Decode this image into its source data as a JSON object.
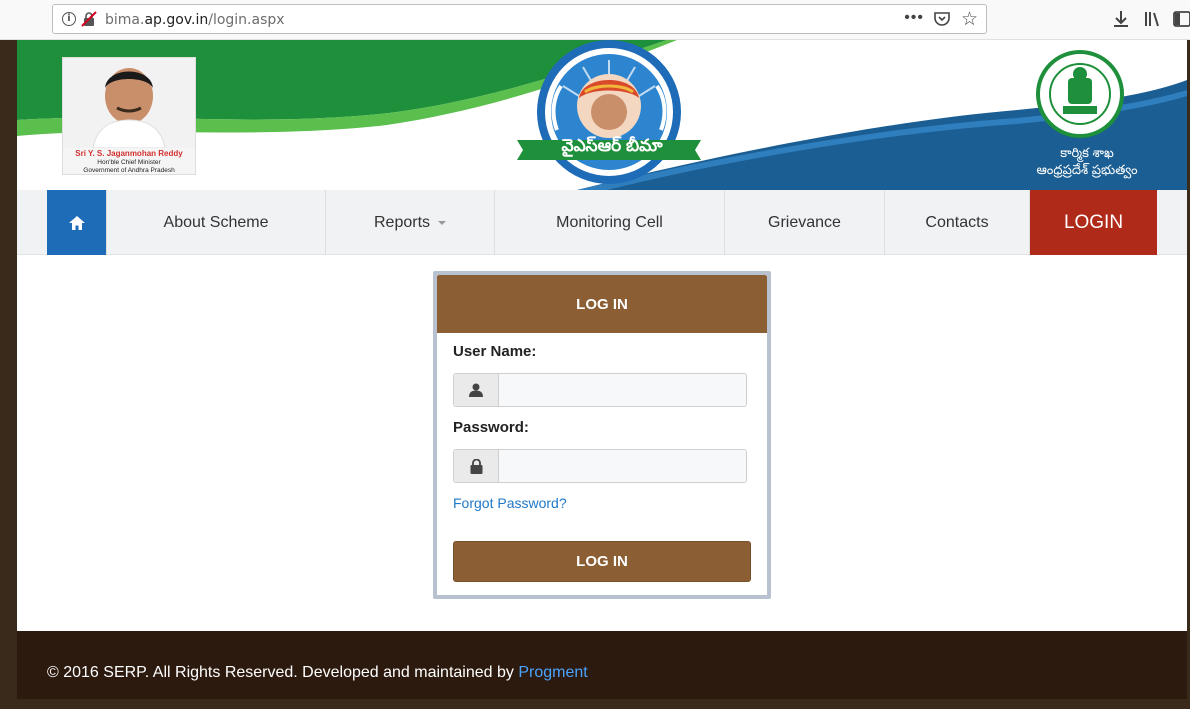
{
  "browser": {
    "url_prefix": "bima.",
    "url_domain": "ap.gov.in",
    "url_path": "/login.aspx",
    "more_glyph": "•••"
  },
  "header": {
    "cm_name": "Sri Y. S. Jaganmohan Reddy",
    "cm_title": "Hon'ble Chief Minister",
    "cm_govt": "Government of Andhra Pradesh",
    "scheme_name": "వైఎస్ఆర్ బీమా",
    "dept_line1": "కార్మిక శాఖ",
    "dept_line2": "ఆంధ్రప్రదేశ్ ప్రభుత్వం"
  },
  "nav": {
    "items": [
      {
        "label": "About Scheme"
      },
      {
        "label": "Reports"
      },
      {
        "label": "Monitoring Cell"
      },
      {
        "label": "Grievance"
      },
      {
        "label": "Contacts"
      },
      {
        "label": "LOGIN"
      }
    ]
  },
  "login": {
    "title": "LOG IN",
    "username_label": "User Name:",
    "username_value": "",
    "password_label": "Password:",
    "password_value": "",
    "forgot_label": "Forgot Password?",
    "submit_label": "LOG IN"
  },
  "footer": {
    "text": "© 2016 SERP. All Rights Reserved. Developed and maintained by ",
    "link_label": "Progment"
  },
  "colors": {
    "brown": "#8b5e34",
    "home_blue": "#1e6bb8",
    "login_red": "#b02a1a",
    "footer_bg": "#2c1a0e",
    "banner_green": "#1e8f3a",
    "banner_blue": "#1b5e93"
  }
}
